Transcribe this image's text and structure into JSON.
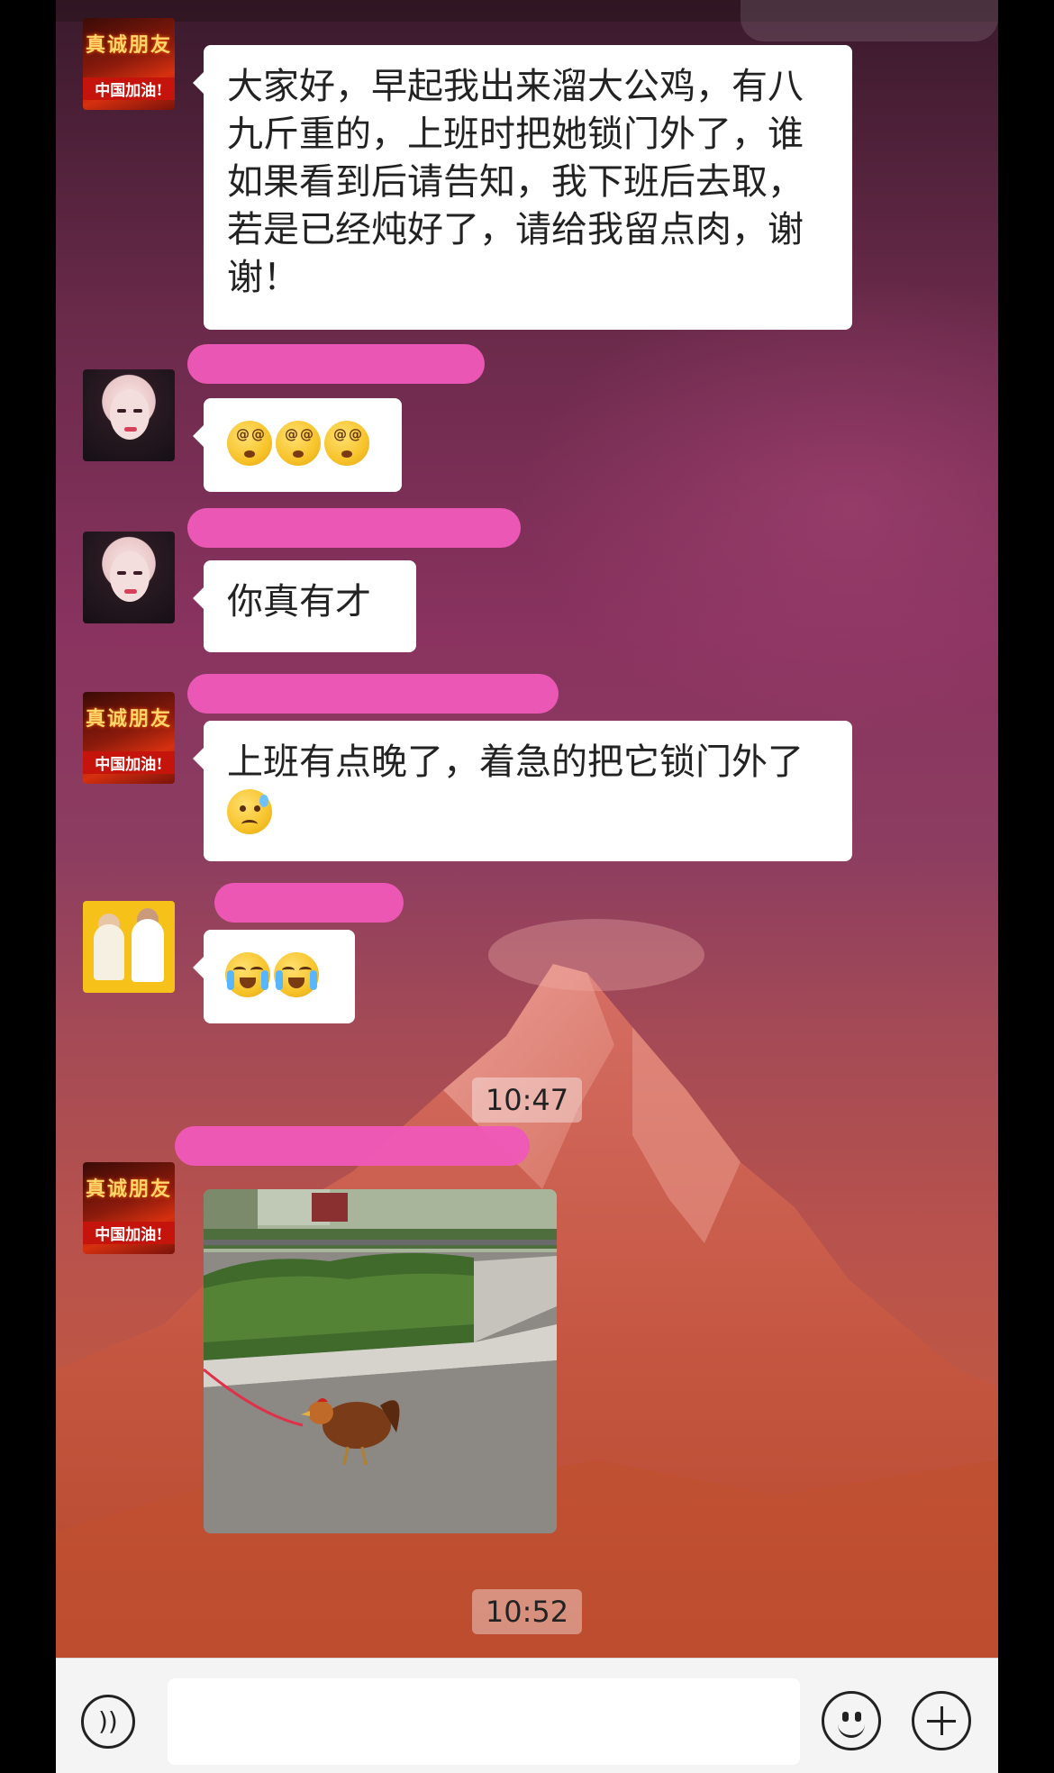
{
  "chat": {
    "messages": [
      {
        "sender": "avatar-red",
        "type": "text",
        "text": "大家好，早起我出来溜大公鸡，有八九斤重的，上班时把她锁门外了，谁如果看到后请告知，我下班后去取，若是已经炖好了，请给我留点肉，谢谢！"
      },
      {
        "sender": "avatar-woman",
        "type": "emoji",
        "emojis": [
          "dizzy-face",
          "dizzy-face",
          "dizzy-face"
        ]
      },
      {
        "sender": "avatar-woman",
        "type": "text",
        "text": "你真有才"
      },
      {
        "sender": "avatar-red",
        "type": "text",
        "text": "上班有点晚了，着急的把它锁门外了",
        "trailing_emoji": "sad-sweat-face"
      },
      {
        "sender": "avatar-couple",
        "type": "emoji",
        "emojis": [
          "crying-face",
          "crying-face"
        ]
      },
      {
        "sender": "avatar-red",
        "type": "image",
        "alt": "rooster-on-leash-photo"
      }
    ],
    "timestamps": [
      "10:47",
      "10:52"
    ]
  },
  "avatars": {
    "red": {
      "line1": "真诚朋友",
      "line2": "中国加油!"
    }
  },
  "input_bar": {
    "placeholder": "",
    "icons": [
      "voice-icon",
      "emoji-icon",
      "plus-icon"
    ]
  },
  "colors": {
    "redaction": "#ef58b8",
    "bubble": "#ffffff",
    "input_bar": "#f4f4f4"
  }
}
